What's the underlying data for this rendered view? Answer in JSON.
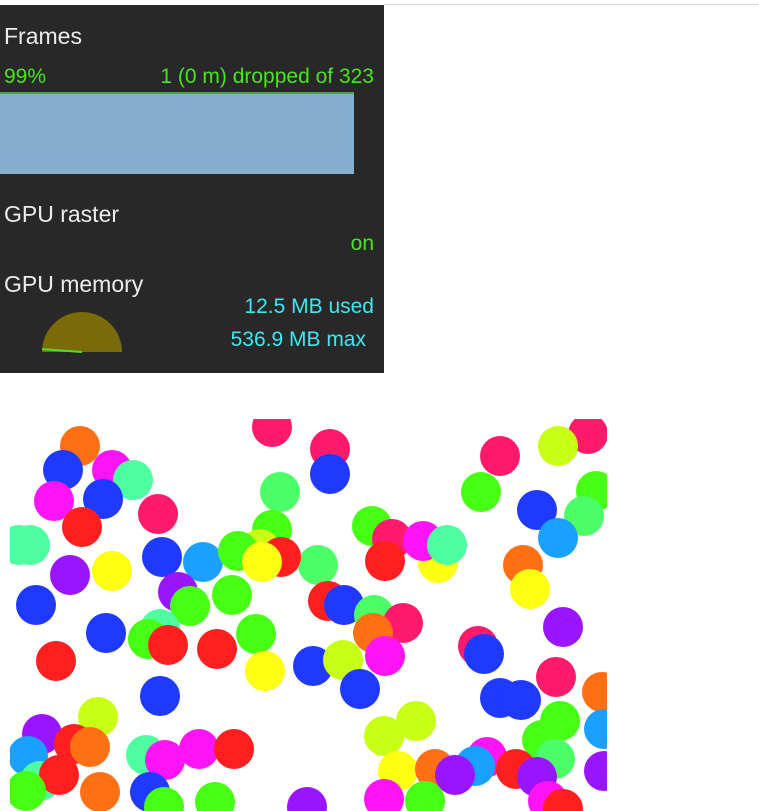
{
  "hud": {
    "frames": {
      "title": "Frames",
      "percent_label": "99%",
      "dropped_label": "1 (0 m) dropped of 323",
      "good_fraction": 0.99
    },
    "gpu_raster": {
      "title": "GPU raster",
      "status": "on"
    },
    "gpu_memory": {
      "title": "GPU memory",
      "used_label": "12.5 MB used",
      "max_label": "536.9 MB max",
      "used_fraction": 0.023
    }
  },
  "colors": {
    "hud_background": "#282828",
    "hud_text": "#ececec",
    "hud_green": "#47e61a",
    "hud_cyan": "#3ee8f2",
    "frame_bar": "#86aecd",
    "gauge_fill": "#7a6a0a",
    "gauge_needle": "#47e61a"
  },
  "scene": {
    "description_free": true,
    "ball_palette": [
      "#ff1a6b",
      "#1f39ff",
      "#47ff14",
      "#ff1f1f",
      "#ffff14",
      "#9a14ff",
      "#1aa0ff",
      "#ff6f14",
      "#4dffa0",
      "#ff14f5",
      "#c8ff14",
      "#4dff66"
    ]
  }
}
